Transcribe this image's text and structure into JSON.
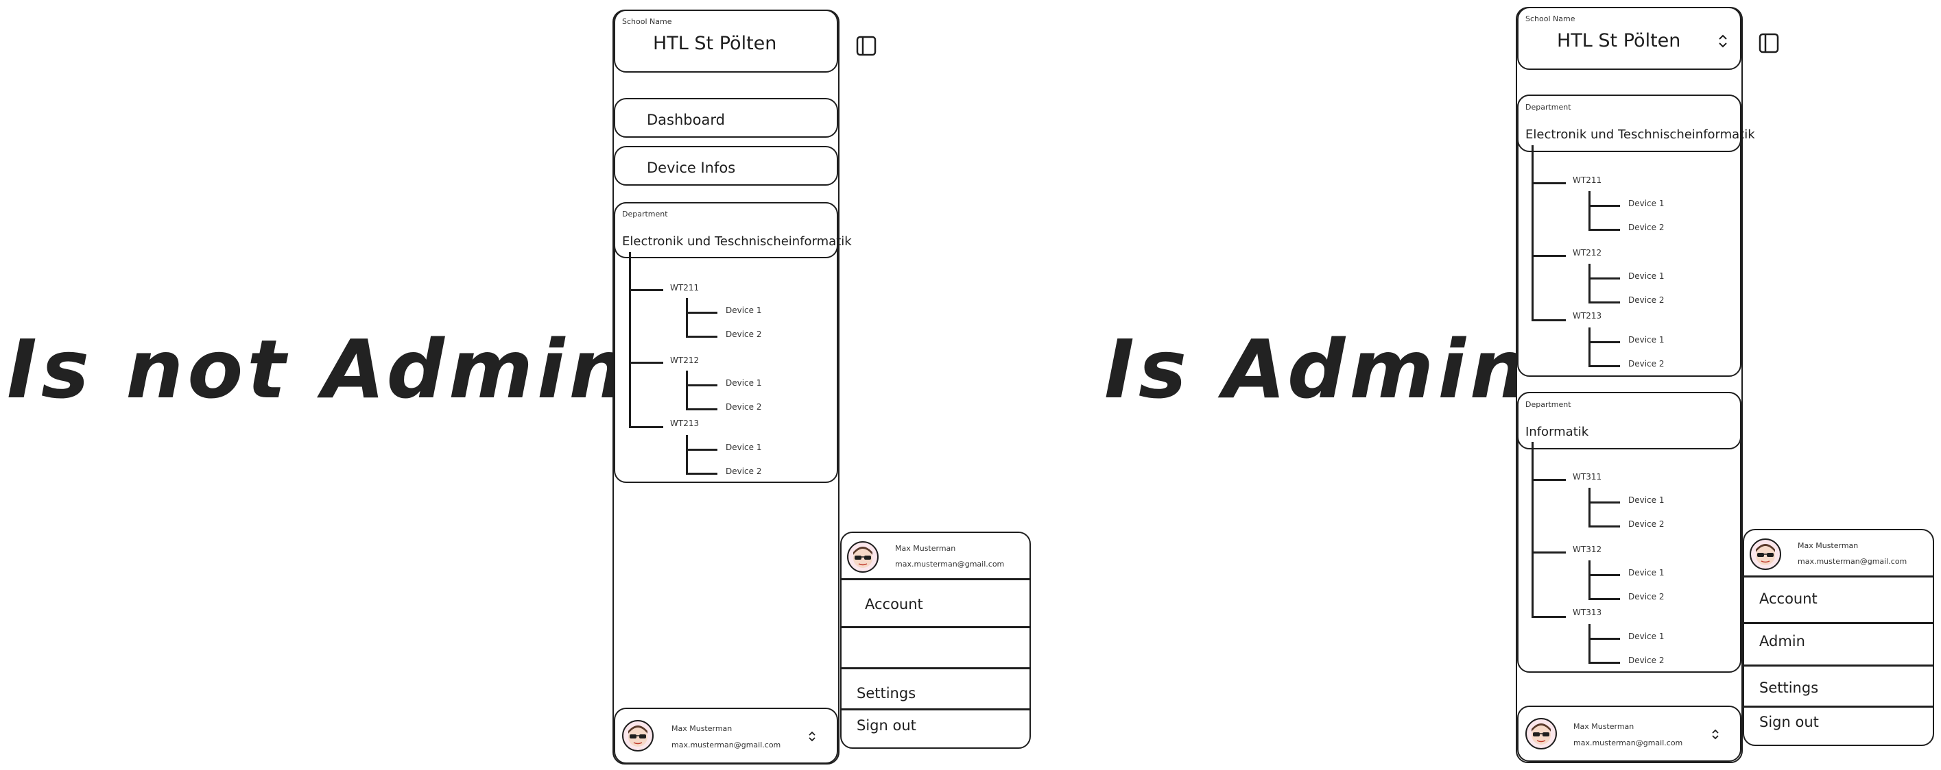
{
  "labels": {
    "left": "Is not Admin",
    "right": "Is Admin"
  },
  "school": {
    "caption": "School Name",
    "name": "HTL St Pölten"
  },
  "nav": {
    "dashboard": "Dashboard",
    "device_infos": "Device Infos"
  },
  "departments": [
    {
      "caption": "Department",
      "name": "Electronik und Teschnischeinformatik",
      "classes": [
        {
          "name": "WT211",
          "devices": [
            "Device 1",
            "Device 2"
          ]
        },
        {
          "name": "WT212",
          "devices": [
            "Device 1",
            "Device 2"
          ]
        },
        {
          "name": "WT213",
          "devices": [
            "Device 1",
            "Device 2"
          ]
        }
      ]
    },
    {
      "caption": "Department",
      "name": "Informatik",
      "classes": [
        {
          "name": "WT311",
          "devices": [
            "Device 1",
            "Device 2"
          ]
        },
        {
          "name": "WT312",
          "devices": [
            "Device 1",
            "Device 2"
          ]
        },
        {
          "name": "WT313",
          "devices": [
            "Device 1",
            "Device 2"
          ]
        }
      ]
    }
  ],
  "user": {
    "name": "Max Musterman",
    "email": "max.musterman@gmail.com"
  },
  "menu_non_admin": {
    "account": "Account",
    "settings": "Settings",
    "sign_out": "Sign out"
  },
  "menu_admin": {
    "account": "Account",
    "admin": "Admin",
    "settings": "Settings",
    "sign_out": "Sign out"
  }
}
